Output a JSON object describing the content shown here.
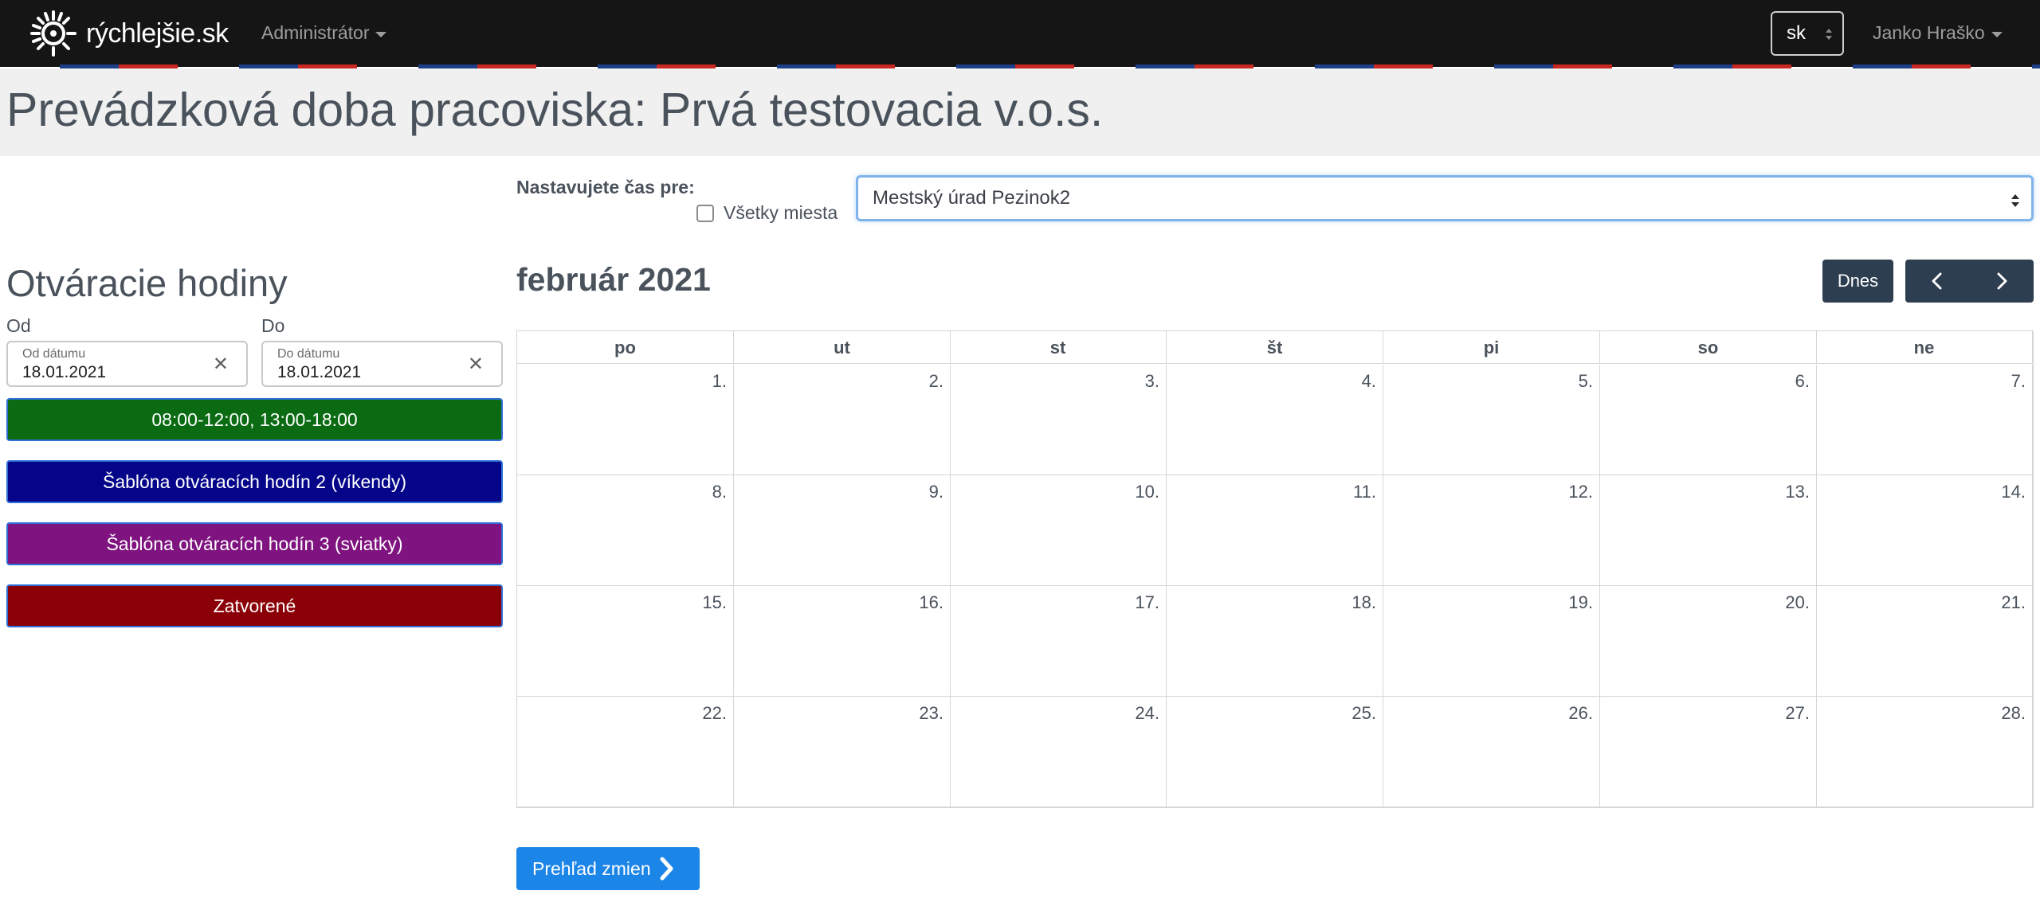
{
  "navbar": {
    "brand": "rýchlejšie.sk",
    "admin_menu": "Administrátor",
    "language": "sk",
    "user_menu": "Janko Hraško"
  },
  "page": {
    "title": "Prevádzková doba pracoviska: Prvá testovacia v.o.s."
  },
  "place": {
    "label": "Nastavujete čas pre:",
    "all_places_label": "Všetky miesta",
    "all_places_checked": false,
    "selected": "Mestský úrad Pezinok2"
  },
  "hours": {
    "title": "Otváracie hodiny",
    "from_label": "Od",
    "to_label": "Do",
    "from_placeholder": "Od dátumu",
    "from_value": "18.01.2021",
    "to_placeholder": "Do dátumu",
    "to_value": "18.01.2021",
    "templates": [
      {
        "label": "08:00-12:00, 13:00-18:00",
        "color": "#0a6b12"
      },
      {
        "label": "Šablóna otváracích hodín 2 (víkendy)",
        "color": "#05058a"
      },
      {
        "label": "Šablóna otváracích hodín 3 (sviatky)",
        "color": "#7f137f"
      },
      {
        "label": "Zatvorené",
        "color": "#8b0006"
      }
    ]
  },
  "calendar": {
    "month": "február 2021",
    "today_button": "Dnes",
    "weekdays": [
      "po",
      "ut",
      "st",
      "št",
      "pi",
      "so",
      "ne"
    ],
    "weeks": [
      [
        "1.",
        "2.",
        "3.",
        "4.",
        "5.",
        "6.",
        "7."
      ],
      [
        "8.",
        "9.",
        "10.",
        "11.",
        "12.",
        "13.",
        "14."
      ],
      [
        "15.",
        "16.",
        "17.",
        "18.",
        "19.",
        "20.",
        "21."
      ],
      [
        "22.",
        "23.",
        "24.",
        "25.",
        "26.",
        "27.",
        "28."
      ]
    ]
  },
  "changes_button": "Prehľad zmien"
}
